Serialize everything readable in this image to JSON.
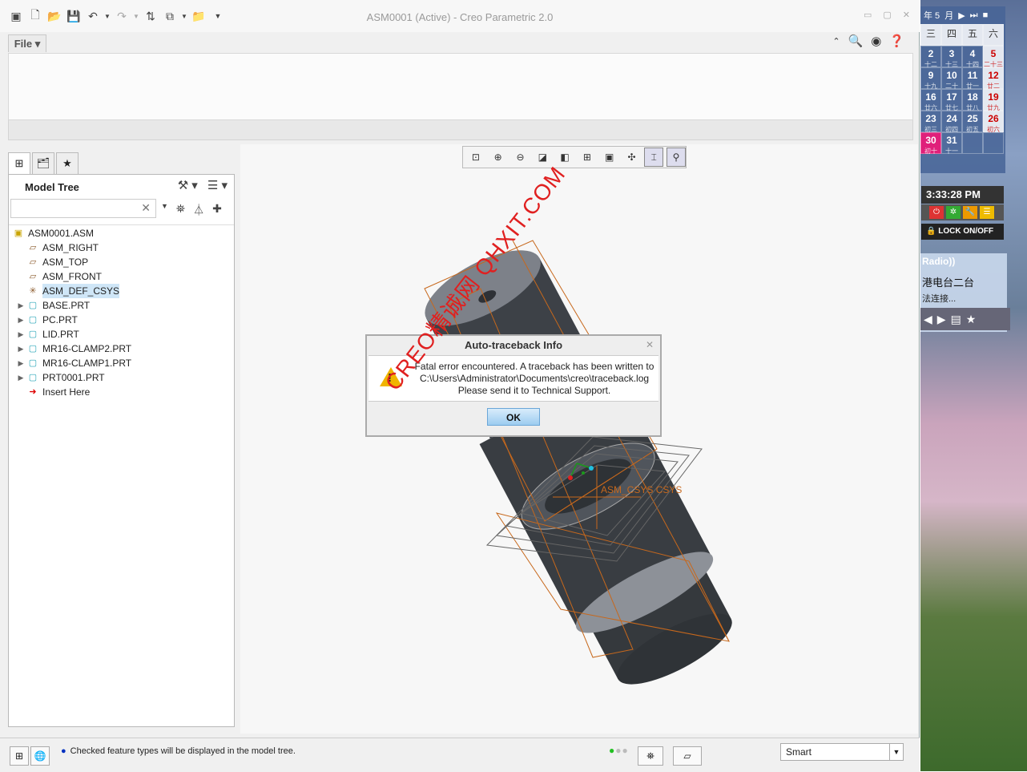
{
  "window": {
    "title": "ASM0001 (Active) - Creo Parametric 2.0"
  },
  "ribbon": {
    "file_tab": "File"
  },
  "model_tree": {
    "header": "Model Tree",
    "search_placeholder": "",
    "items": [
      {
        "label": "ASM0001.ASM",
        "icon": "assembly-icon",
        "expandable": false,
        "indent": 0
      },
      {
        "label": "ASM_RIGHT",
        "icon": "datum-plane-icon",
        "expandable": false,
        "indent": 1
      },
      {
        "label": "ASM_TOP",
        "icon": "datum-plane-icon",
        "expandable": false,
        "indent": 1
      },
      {
        "label": "ASM_FRONT",
        "icon": "datum-plane-icon",
        "expandable": false,
        "indent": 1
      },
      {
        "label": "ASM_DEF_CSYS",
        "icon": "csys-icon",
        "expandable": false,
        "indent": 1,
        "selected": true
      },
      {
        "label": "BASE.PRT",
        "icon": "part-icon",
        "expandable": true,
        "indent": 1
      },
      {
        "label": "PC.PRT",
        "icon": "part-icon",
        "expandable": true,
        "indent": 1
      },
      {
        "label": "LID.PRT",
        "icon": "part-icon",
        "expandable": true,
        "indent": 1
      },
      {
        "label": "MR16-CLAMP2.PRT",
        "icon": "part-icon",
        "expandable": true,
        "indent": 1
      },
      {
        "label": "MR16-CLAMP1.PRT",
        "icon": "part-icon",
        "expandable": true,
        "indent": 1
      },
      {
        "label": "PRT0001.PRT",
        "icon": "part-icon",
        "expandable": true,
        "indent": 1
      },
      {
        "label": "Insert Here",
        "icon": "insert-here-icon",
        "expandable": false,
        "indent": 1
      }
    ]
  },
  "viewport": {
    "csys_label": "ASM_CSYS CSYS"
  },
  "dialog": {
    "title": "Auto-traceback Info",
    "line1": "Fatal error encountered. A traceback has been written to",
    "line2": "C:\\Users\\Administrator\\Documents\\creo\\traceback.log",
    "line3": "Please send it to Technical Support.",
    "ok_label": "OK"
  },
  "status": {
    "message": "Checked feature types will be displayed in the model tree.",
    "filter_value": "Smart"
  },
  "desktop": {
    "calendar": {
      "header_year": "年 5",
      "header_month": "月",
      "weekdays": [
        "三",
        "四",
        "五",
        "六"
      ],
      "cells": [
        {
          "day": "2",
          "lunar": "十二"
        },
        {
          "day": "3",
          "lunar": "十三"
        },
        {
          "day": "4",
          "lunar": "十四"
        },
        {
          "day": "5",
          "lunar": "二十三",
          "red": true
        },
        {
          "day": "9",
          "lunar": "十九"
        },
        {
          "day": "10",
          "lunar": "二十"
        },
        {
          "day": "11",
          "lunar": "廿一"
        },
        {
          "day": "12",
          "lunar": "廿二",
          "red": true
        },
        {
          "day": "16",
          "lunar": "廿六"
        },
        {
          "day": "17",
          "lunar": "廿七"
        },
        {
          "day": "18",
          "lunar": "廿八"
        },
        {
          "day": "19",
          "lunar": "廿九",
          "red": true
        },
        {
          "day": "23",
          "lunar": "初三"
        },
        {
          "day": "24",
          "lunar": "初四"
        },
        {
          "day": "25",
          "lunar": "初五"
        },
        {
          "day": "26",
          "lunar": "初六",
          "red": true
        },
        {
          "day": "30",
          "lunar": "初十",
          "today": true
        },
        {
          "day": "31",
          "lunar": "十一"
        },
        {
          "day": "",
          "lunar": ""
        },
        {
          "day": "",
          "lunar": ""
        }
      ]
    },
    "clock": "3:33:28 PM",
    "lock_label": "LOCK ON/OFF",
    "radio": {
      "title": "Radio",
      "station": "港电台二台",
      "connecting": "法连接..."
    }
  },
  "watermark": "CREO精诚网 QHXIT.COM",
  "colors": {
    "dialog_ok": "#9cccf0",
    "warning": "#f0b400",
    "watermark": "#e02020",
    "selected_row": "#cfe6f7"
  }
}
